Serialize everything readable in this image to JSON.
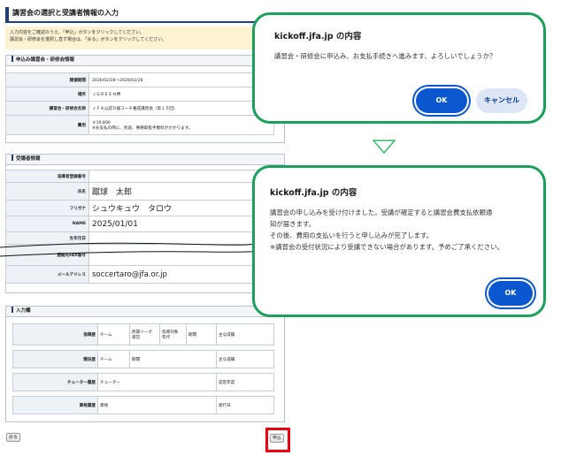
{
  "page": {
    "title": "講習会の選択と受講者情報の入力",
    "notice_line1": "入力内容をご確認のうえ、「申込」ボタンをクリックしてください。",
    "notice_line2": "講習会・研修会を選択し直す場合は、「戻る」ボタンをクリックしてください。"
  },
  "course_section": {
    "heading": "申込み講習会・研修会情報",
    "rows": [
      {
        "label": "開催期間",
        "value": "2026/02/28～2026/02/28"
      },
      {
        "label": "場所",
        "value": "ＪＧＲＥＥＮ堺"
      },
      {
        "label": "講習会・研修会名称",
        "value": "ＪＦＡ公認Ｄ級コーチ養成講習会（第１５回）"
      },
      {
        "label": "費用",
        "value": "￥19,800",
        "note": "※お支払の際に、別途、事務取扱手数料がかかります。"
      }
    ]
  },
  "student_section": {
    "heading": "受講者情報",
    "rows": [
      {
        "label": "指導者登録番号",
        "value": ""
      },
      {
        "label": "氏名",
        "value": "蹴球　太郎"
      },
      {
        "label": "フリガナ",
        "value": "シュウキュウ　タロウ"
      },
      {
        "label": "NAME",
        "value": "2025/01/01"
      },
      {
        "label": "生年月日",
        "value": ""
      },
      {
        "label": "連絡先FAX番号",
        "value": ""
      },
      {
        "label": "メールアドレス",
        "value": "soccertaro@jfa.or.jp"
      }
    ]
  },
  "input_section": {
    "heading": "入力欄",
    "coaching": {
      "label": "指導歴",
      "cols": [
        "チーム",
        "所属リーグ\n運営",
        "指導対象\n年代",
        "期間",
        "主な成績"
      ]
    },
    "playing": {
      "label": "競技歴",
      "cols": [
        "チーム",
        "期間",
        "主な成績"
      ]
    },
    "tutor": {
      "label": "チューター履歴",
      "cols": [
        "チューター",
        "認定年度"
      ]
    },
    "license": {
      "label": "資格履歴",
      "cols": [
        "資格",
        "発行日"
      ]
    }
  },
  "buttons": {
    "back": "戻る",
    "apply": "申込"
  },
  "dialog1": {
    "title": "kickoff.jfa.jp の内容",
    "message": "講習会・研修会に申込み、お支払手続きへ進みます、よろしいでしょうか？",
    "ok": "OK",
    "cancel": "キャンセル"
  },
  "dialog2": {
    "title": "kickoff.jfa.jp の内容",
    "line1": "講習会の申し込みを受け付けました。受講が確定すると講習会費支払依頼通",
    "line2": "知が届きます。",
    "line3": "その後、費用の支払いを行うと申し込みが完了します。",
    "line4": "※講習会の受付状況により受講できない場合があります。予めご了承ください。",
    "ok": "OK"
  },
  "colors": {
    "dialog_border": "#1aa05a",
    "primary_button": "#0b57d0",
    "highlight_box": "#e60012",
    "arrow": "#3cba6a"
  }
}
